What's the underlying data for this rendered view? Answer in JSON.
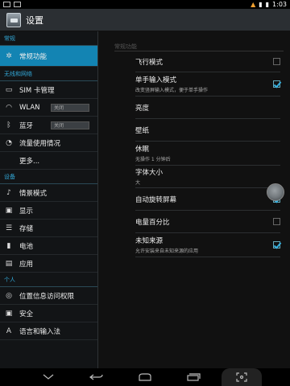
{
  "status_bar": {
    "time": "1:03"
  },
  "action_bar": {
    "title": "设置"
  },
  "left_pane": {
    "sections": [
      {
        "header": "常规",
        "items": [
          {
            "label": "常规功能",
            "icon": "gear-icon",
            "active": true
          }
        ]
      },
      {
        "header": "无线和网络",
        "items": [
          {
            "label": "SIM 卡管理",
            "icon": "sim-icon"
          },
          {
            "label": "WLAN",
            "icon": "wifi-icon",
            "toggle": "关闭"
          },
          {
            "label": "蓝牙",
            "icon": "bluetooth-icon",
            "toggle": "关闭"
          },
          {
            "label": "流量使用情况",
            "icon": "data-usage-icon"
          },
          {
            "label": "更多...",
            "icon": ""
          }
        ]
      },
      {
        "header": "设备",
        "items": [
          {
            "label": "情景模式",
            "icon": "profile-icon"
          },
          {
            "label": "显示",
            "icon": "display-icon"
          },
          {
            "label": "存储",
            "icon": "storage-icon"
          },
          {
            "label": "电池",
            "icon": "battery-icon"
          },
          {
            "label": "应用",
            "icon": "apps-icon"
          }
        ]
      },
      {
        "header": "个人",
        "items": [
          {
            "label": "位置信息访问权限",
            "icon": "location-icon"
          },
          {
            "label": "安全",
            "icon": "lock-icon"
          },
          {
            "label": "语言和输入法",
            "icon": "language-icon"
          }
        ]
      }
    ]
  },
  "right_pane": {
    "header": "常规功能",
    "items": [
      {
        "title": "飞行模式",
        "checkbox": false
      },
      {
        "title": "单手输入模式",
        "summary": "改变竖屏输入模式，便于单手操作",
        "checkbox": true
      },
      {
        "title": "亮度"
      },
      {
        "title": "壁纸"
      },
      {
        "title": "休眠",
        "summary": "无操作 1 分钟后"
      },
      {
        "title": "字体大小",
        "summary": "大"
      },
      {
        "title": "自动旋转屏幕",
        "checkbox": true
      },
      {
        "title": "电量百分比",
        "checkbox": false
      },
      {
        "title": "未知来源",
        "summary": "允许安装来自未知来源的应用",
        "checkbox": true
      }
    ]
  },
  "colors": {
    "accent": "#1384b3",
    "section_header": "#32a7d6",
    "check": "#35b1e0"
  }
}
